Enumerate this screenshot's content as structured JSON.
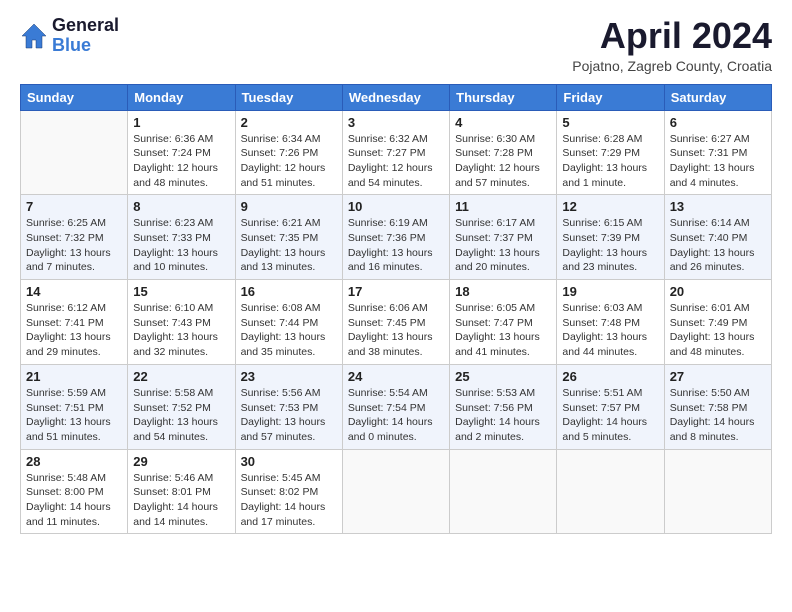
{
  "logo": {
    "general": "General",
    "blue": "Blue"
  },
  "header": {
    "month": "April 2024",
    "location": "Pojatno, Zagreb County, Croatia"
  },
  "weekdays": [
    "Sunday",
    "Monday",
    "Tuesday",
    "Wednesday",
    "Thursday",
    "Friday",
    "Saturday"
  ],
  "weeks": [
    [
      {
        "day": "",
        "info": ""
      },
      {
        "day": "1",
        "info": "Sunrise: 6:36 AM\nSunset: 7:24 PM\nDaylight: 12 hours\nand 48 minutes."
      },
      {
        "day": "2",
        "info": "Sunrise: 6:34 AM\nSunset: 7:26 PM\nDaylight: 12 hours\nand 51 minutes."
      },
      {
        "day": "3",
        "info": "Sunrise: 6:32 AM\nSunset: 7:27 PM\nDaylight: 12 hours\nand 54 minutes."
      },
      {
        "day": "4",
        "info": "Sunrise: 6:30 AM\nSunset: 7:28 PM\nDaylight: 12 hours\nand 57 minutes."
      },
      {
        "day": "5",
        "info": "Sunrise: 6:28 AM\nSunset: 7:29 PM\nDaylight: 13 hours\nand 1 minute."
      },
      {
        "day": "6",
        "info": "Sunrise: 6:27 AM\nSunset: 7:31 PM\nDaylight: 13 hours\nand 4 minutes."
      }
    ],
    [
      {
        "day": "7",
        "info": "Sunrise: 6:25 AM\nSunset: 7:32 PM\nDaylight: 13 hours\nand 7 minutes."
      },
      {
        "day": "8",
        "info": "Sunrise: 6:23 AM\nSunset: 7:33 PM\nDaylight: 13 hours\nand 10 minutes."
      },
      {
        "day": "9",
        "info": "Sunrise: 6:21 AM\nSunset: 7:35 PM\nDaylight: 13 hours\nand 13 minutes."
      },
      {
        "day": "10",
        "info": "Sunrise: 6:19 AM\nSunset: 7:36 PM\nDaylight: 13 hours\nand 16 minutes."
      },
      {
        "day": "11",
        "info": "Sunrise: 6:17 AM\nSunset: 7:37 PM\nDaylight: 13 hours\nand 20 minutes."
      },
      {
        "day": "12",
        "info": "Sunrise: 6:15 AM\nSunset: 7:39 PM\nDaylight: 13 hours\nand 23 minutes."
      },
      {
        "day": "13",
        "info": "Sunrise: 6:14 AM\nSunset: 7:40 PM\nDaylight: 13 hours\nand 26 minutes."
      }
    ],
    [
      {
        "day": "14",
        "info": "Sunrise: 6:12 AM\nSunset: 7:41 PM\nDaylight: 13 hours\nand 29 minutes."
      },
      {
        "day": "15",
        "info": "Sunrise: 6:10 AM\nSunset: 7:43 PM\nDaylight: 13 hours\nand 32 minutes."
      },
      {
        "day": "16",
        "info": "Sunrise: 6:08 AM\nSunset: 7:44 PM\nDaylight: 13 hours\nand 35 minutes."
      },
      {
        "day": "17",
        "info": "Sunrise: 6:06 AM\nSunset: 7:45 PM\nDaylight: 13 hours\nand 38 minutes."
      },
      {
        "day": "18",
        "info": "Sunrise: 6:05 AM\nSunset: 7:47 PM\nDaylight: 13 hours\nand 41 minutes."
      },
      {
        "day": "19",
        "info": "Sunrise: 6:03 AM\nSunset: 7:48 PM\nDaylight: 13 hours\nand 44 minutes."
      },
      {
        "day": "20",
        "info": "Sunrise: 6:01 AM\nSunset: 7:49 PM\nDaylight: 13 hours\nand 48 minutes."
      }
    ],
    [
      {
        "day": "21",
        "info": "Sunrise: 5:59 AM\nSunset: 7:51 PM\nDaylight: 13 hours\nand 51 minutes."
      },
      {
        "day": "22",
        "info": "Sunrise: 5:58 AM\nSunset: 7:52 PM\nDaylight: 13 hours\nand 54 minutes."
      },
      {
        "day": "23",
        "info": "Sunrise: 5:56 AM\nSunset: 7:53 PM\nDaylight: 13 hours\nand 57 minutes."
      },
      {
        "day": "24",
        "info": "Sunrise: 5:54 AM\nSunset: 7:54 PM\nDaylight: 14 hours\nand 0 minutes."
      },
      {
        "day": "25",
        "info": "Sunrise: 5:53 AM\nSunset: 7:56 PM\nDaylight: 14 hours\nand 2 minutes."
      },
      {
        "day": "26",
        "info": "Sunrise: 5:51 AM\nSunset: 7:57 PM\nDaylight: 14 hours\nand 5 minutes."
      },
      {
        "day": "27",
        "info": "Sunrise: 5:50 AM\nSunset: 7:58 PM\nDaylight: 14 hours\nand 8 minutes."
      }
    ],
    [
      {
        "day": "28",
        "info": "Sunrise: 5:48 AM\nSunset: 8:00 PM\nDaylight: 14 hours\nand 11 minutes."
      },
      {
        "day": "29",
        "info": "Sunrise: 5:46 AM\nSunset: 8:01 PM\nDaylight: 14 hours\nand 14 minutes."
      },
      {
        "day": "30",
        "info": "Sunrise: 5:45 AM\nSunset: 8:02 PM\nDaylight: 14 hours\nand 17 minutes."
      },
      {
        "day": "",
        "info": ""
      },
      {
        "day": "",
        "info": ""
      },
      {
        "day": "",
        "info": ""
      },
      {
        "day": "",
        "info": ""
      }
    ]
  ]
}
